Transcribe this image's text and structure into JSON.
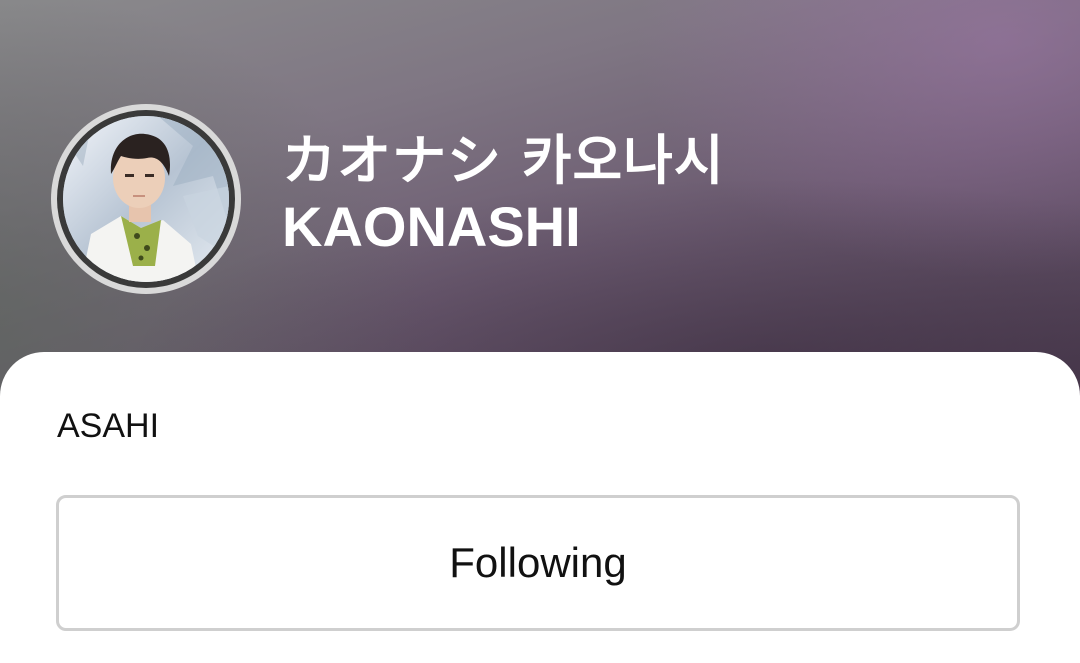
{
  "profile": {
    "title_native": "カオナシ 카오나시",
    "title_latin": "KAONASHI",
    "member_name": "ASAHI",
    "avatar_icon": "avatar-photo"
  },
  "actions": {
    "follow_label": "Following"
  },
  "colors": {
    "header_dark": "#4a3a4e",
    "header_mid": "#7f7683",
    "accent_purple": "#8e6f98",
    "button_border": "#cfcfcf",
    "text_primary": "#111111"
  }
}
